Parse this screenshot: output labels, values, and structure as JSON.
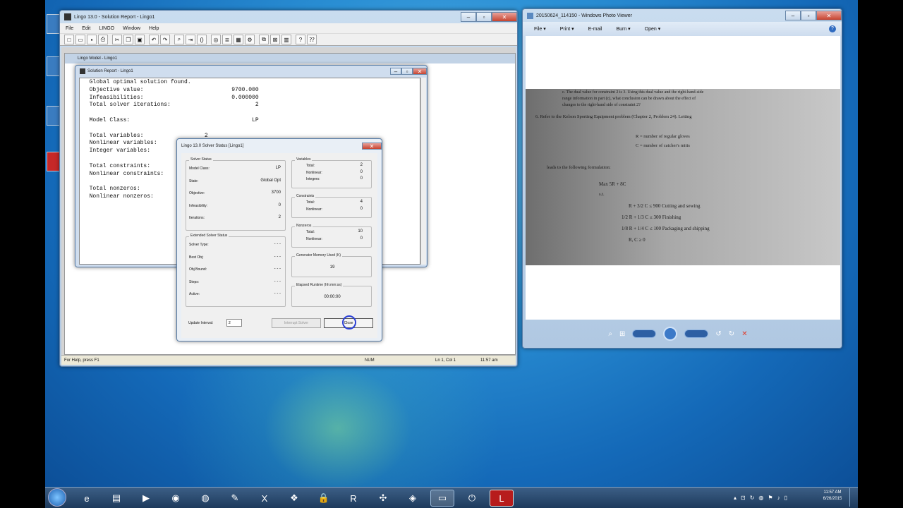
{
  "lingo": {
    "title": "Lingo 13.0 - Solution Report - Lingo1",
    "menu": [
      "File",
      "Edit",
      "LINGO",
      "Window",
      "Help"
    ],
    "model_title": "Lingo Model - Lingo1",
    "status": {
      "help": "For Help, press F1",
      "num": "NUM",
      "pos": "Ln 1, Col 1",
      "time": "11:57 am"
    }
  },
  "report": {
    "title": "Solution Report - Lingo1",
    "lines": [
      "  Global optimal solution found.",
      "  Objective value:                          9700.000",
      "  Infeasibilities:                          0.000000",
      "  Total solver iterations:                         2",
      "",
      "  Model Class:                                    LP",
      "",
      "  Total variables:                  2",
      "  Nonlinear variables:",
      "  Integer variables:",
      "",
      "  Total constraints:",
      "  Nonlinear constraints:",
      "",
      "  Total nonzeros:",
      "  Nonlinear nonzeros:"
    ]
  },
  "solver": {
    "title": "Lingo 13.0 Solver Status [Lingo1]",
    "solver_status": {
      "label": "Solver Status",
      "rows": [
        {
          "k": "Model Class:",
          "v": "LP"
        },
        {
          "k": "State:",
          "v": "Global Opt"
        },
        {
          "k": "Objective:",
          "v": "3700"
        },
        {
          "k": "Infeasibility:",
          "v": "0"
        },
        {
          "k": "Iterations:",
          "v": "2"
        }
      ]
    },
    "variables": {
      "label": "Variables",
      "rows": [
        {
          "k": "Total:",
          "v": "2"
        },
        {
          "k": "Nonlinear:",
          "v": "0"
        },
        {
          "k": "Integers:",
          "v": "0"
        }
      ]
    },
    "constraints": {
      "label": "Constraints",
      "rows": [
        {
          "k": "Total:",
          "v": "4"
        },
        {
          "k": "Nonlinear:",
          "v": "0"
        }
      ]
    },
    "nonzeros": {
      "label": "Nonzeros",
      "rows": [
        {
          "k": "Total:",
          "v": "10"
        },
        {
          "k": "Nonlinear:",
          "v": "0"
        }
      ]
    },
    "extended": {
      "label": "Extended Solver Status",
      "rows": [
        {
          "k": "Solver Type:",
          "v": "- - -"
        },
        {
          "k": "Best Obj:",
          "v": "- - -"
        },
        {
          "k": "Obj Bound:",
          "v": "- - -"
        },
        {
          "k": "Steps:",
          "v": "- - -"
        },
        {
          "k": "Active:",
          "v": "- - -"
        }
      ]
    },
    "memory": {
      "label": "Generator Memory Used (K)",
      "value": "19"
    },
    "runtime": {
      "label": "Elapsed Runtime (hh:mm:ss)",
      "value": "00:00:00"
    },
    "update_label": "Update Interval:",
    "update_value": "2",
    "interrupt_label": "Interrupt Solver",
    "close_label": "Close"
  },
  "photo": {
    "title": "20150624_114150 - Windows Photo Viewer",
    "menu": [
      "File ▾",
      "Print ▾",
      "E-mail",
      "Burn ▾",
      "Open ▾"
    ],
    "doc_lines": [
      "c.  The dual value for constraint 2 is 3. Using this dual value and the right-hand-side",
      "range information in part (c), what conclusion can be drawn about the effect of",
      "changes to the right-hand side of constraint 2?",
      "6.  Refer to the Kelson Sporting Equipment problem (Chapter 2, Problem 24). Letting"
    ],
    "vars": [
      "R = number of regular gloves",
      "C = number of catcher's mitts"
    ],
    "leads": "leads to the following formulation:",
    "max": "Max   5R  +  8C",
    "st": "s.t.",
    "constraints": [
      "R  +  3/2 C  ≤  900    Cutting and sewing",
      "1/2 R  +  1/3 C  ≤  300    Finishing",
      "1/8 R  +  1/4 C  ≤  100    Packaging and shipping"
    ],
    "nonneg": "R, C ≥ 0"
  },
  "taskbar": {
    "clock_time": "11:57 AM",
    "clock_date": "6/26/2015",
    "apps": [
      {
        "name": "ie-icon",
        "glyph": "e"
      },
      {
        "name": "explorer-icon",
        "glyph": "▤"
      },
      {
        "name": "media-player-icon",
        "glyph": "▶"
      },
      {
        "name": "chrome-icon",
        "glyph": "◉"
      },
      {
        "name": "firefox-icon",
        "glyph": "◍"
      },
      {
        "name": "paint-icon",
        "glyph": "✎"
      },
      {
        "name": "excel-icon",
        "glyph": "X"
      },
      {
        "name": "dropbox-icon",
        "glyph": "❖"
      },
      {
        "name": "lock-app-icon",
        "glyph": "🔒"
      },
      {
        "name": "r-icon",
        "glyph": "R"
      },
      {
        "name": "network-app-icon",
        "glyph": "✣"
      },
      {
        "name": "disk-icon",
        "glyph": "◈"
      },
      {
        "name": "photo-viewer-icon",
        "glyph": "▭"
      },
      {
        "name": "power-icon",
        "glyph": "⏻"
      },
      {
        "name": "lingo-icon",
        "glyph": "L"
      }
    ]
  }
}
